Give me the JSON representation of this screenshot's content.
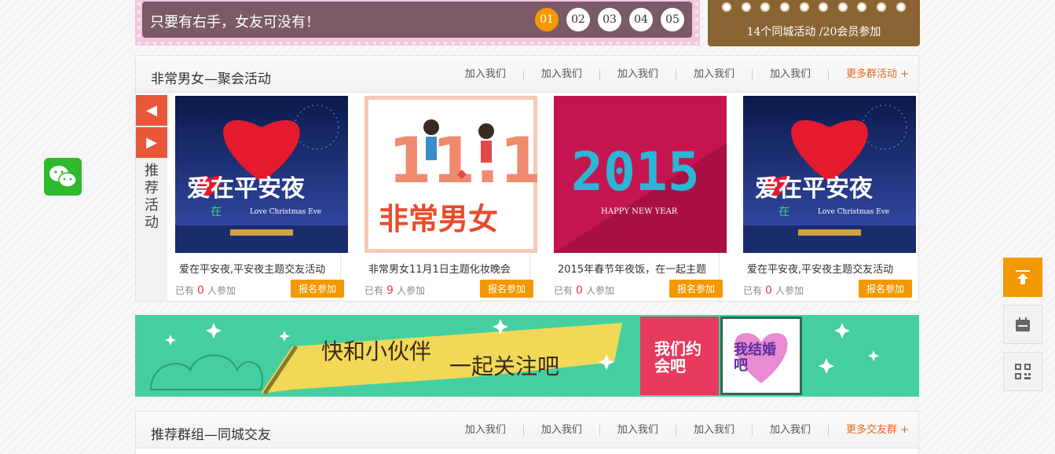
{
  "top_banner": {
    "slogan": "只要有右手，女友可没有！",
    "pager": [
      "01",
      "02",
      "03",
      "04",
      "05"
    ],
    "active_page": "01"
  },
  "stats": {
    "text": "14个同城活动 /20会员参加"
  },
  "section1": {
    "title": "非常男女—聚会活动",
    "links": [
      "加入我们",
      "加入我们",
      "加入我们",
      "加入我们",
      "加入我们"
    ],
    "more": "更多群活动 +",
    "side_label": "推荐活动",
    "cards": [
      {
        "title": "爱在平安夜,平安夜主题交友活动",
        "prefix": "已有",
        "count": "0",
        "suffix": "人参加",
        "button": "报名参加",
        "image": "christmas-eve-poster"
      },
      {
        "title": "非常男女11月1日主题化妆晚会",
        "prefix": "已有",
        "count": "9",
        "suffix": "人参加",
        "button": "报名参加",
        "image": "singles-day-poster"
      },
      {
        "title": "2015年春节年夜饭，在一起主题",
        "prefix": "已有",
        "count": "0",
        "suffix": "人参加",
        "button": "报名参加",
        "image": "new-year-2015-poster"
      },
      {
        "title": "爱在平安夜,平安夜主题交友活动",
        "prefix": "已有",
        "count": "0",
        "suffix": "人参加",
        "button": "报名参加",
        "image": "christmas-eve-poster"
      }
    ],
    "poster_texts": {
      "xmas": "爱在平安夜",
      "xmas_small": "在",
      "xmas_en": "Love Christmas Eve",
      "singles_num": "11.1",
      "singles_name": "非常男女",
      "year": "2015",
      "year_en": "HAPPY NEW YEAR"
    }
  },
  "follow_banner": {
    "line1": "快和小伙伴",
    "line2": "一起关注吧",
    "qr1_label": "我们约会吧",
    "qr2_label": "我结婚吧"
  },
  "section2": {
    "title": "推荐群组—同城交友",
    "links": [
      "加入我们",
      "加入我们",
      "加入我们",
      "加入我们",
      "加入我们"
    ],
    "more": "更多交友群 +"
  },
  "colors": {
    "accent": "#f39800",
    "red": "#e8573a",
    "teal": "#45cfa1",
    "brown": "#8b6434"
  }
}
